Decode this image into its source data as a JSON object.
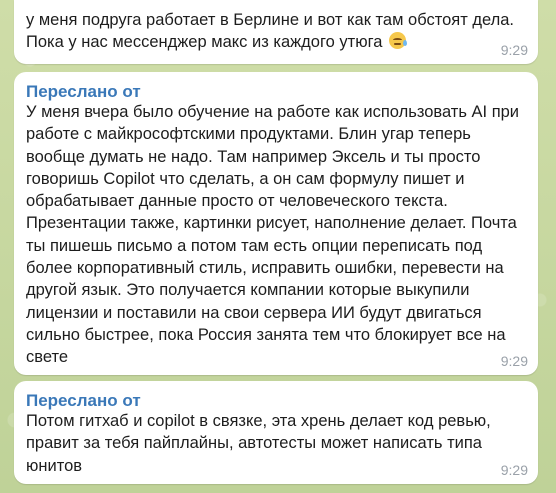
{
  "messages": [
    {
      "text": "у меня подруга работает в Берлине и вот как там обстоят дела.\nПока у нас мессенджер макс из каждого утюга",
      "emoji": "crying-face-icon",
      "time": "9:29"
    },
    {
      "forwarded_label": "Переслано от",
      "text": "У меня вчера было обучение на работе как использовать AI при\nработе с майкрософтскими продуктами. Блин угар теперь\nвообще думать не надо. Там например Эксель и ты просто\nговоришь Copilot что сделать, а он сам формулу пишет и\nобрабатывает данные просто от человеческого текста.\nПрезентации также, картинки рисует, наполнение делает. Почта\nты пишешь письмо а потом там есть опции переписать под\nболее корпоративный стиль, исправить ошибки, перевести на\nдругой язык. Это получается компании которые выкупили\nлицензии и поставили на свои сервера ИИ будут двигаться\nсильно быстрее, пока Россия занята тем что блокирует все на\nсвете",
      "time": "9:29"
    },
    {
      "forwarded_label": "Переслано от",
      "text": "Потом гитхаб и copilot в связке, эта хрень делает код ревью,\nправит за тебя пайплайны, автотесты может написать типа\nюнитов",
      "time": "9:29"
    }
  ],
  "colors": {
    "background": "#c9d9a2",
    "bubble": "#ffffff",
    "forwarded_label": "#3a78b8",
    "time": "#9aa1a9"
  }
}
